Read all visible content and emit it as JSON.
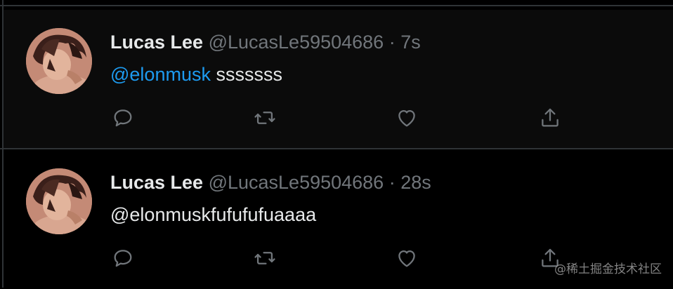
{
  "tweets": [
    {
      "display_name": "Lucas Lee",
      "handle": "@LucasLe59504686",
      "separator": "·",
      "time": "7s",
      "mention": "@elonmusk",
      "body": " sssssss",
      "mention_color": "#1d9bf0"
    },
    {
      "display_name": "Lucas Lee",
      "handle": "@LucasLe59504686",
      "separator": "·",
      "time": "28s",
      "mention": "",
      "body": "@elonmuskfufufufuaaaa"
    }
  ],
  "icons": {
    "reply": "reply-icon",
    "retweet": "retweet-icon",
    "like": "heart-icon",
    "share": "share-icon"
  },
  "watermark": "@稀土掘金技术社区",
  "colors": {
    "background": "#000000",
    "text_primary": "#e7e9ea",
    "text_secondary": "#71767b",
    "accent": "#1d9bf0",
    "divider": "#2f3336"
  }
}
